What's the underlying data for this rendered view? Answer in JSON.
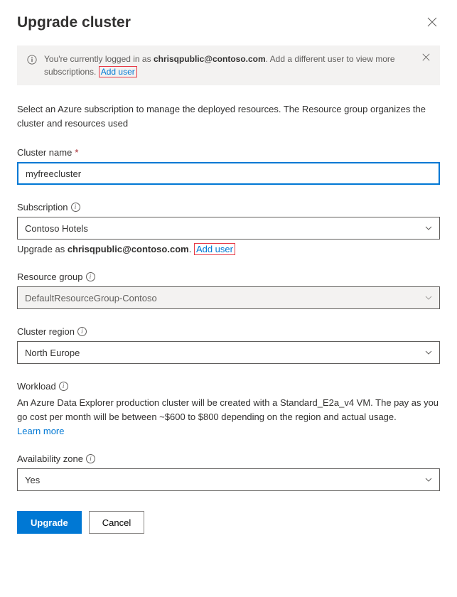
{
  "header": {
    "title": "Upgrade cluster",
    "close_label": "✕"
  },
  "banner": {
    "prefix": "You're currently logged in as ",
    "user": "chrisqpublic@contoso.com",
    "suffix": ". Add a different user to view more subscriptions.",
    "add_user": "Add user",
    "close_label": "✕"
  },
  "intro": "Select an Azure subscription to manage the deployed resources. The Resource group organizes the cluster and resources used",
  "cluster_name": {
    "label": "Cluster name",
    "value": "myfreecluster"
  },
  "subscription": {
    "label": "Subscription",
    "value": "Contoso Hotels",
    "helper_prefix": "Upgrade as ",
    "helper_user": "chrisqpublic@contoso.com",
    "helper_period": ". ",
    "add_user": "Add user"
  },
  "resource_group": {
    "label": "Resource group",
    "value": "DefaultResourceGroup-Contoso"
  },
  "cluster_region": {
    "label": "Cluster region",
    "value": "North Europe"
  },
  "workload": {
    "label": "Workload",
    "description": "An Azure Data Explorer production cluster will be created with a Standard_E2a_v4 VM. The pay as you go cost per month will be between ~$600 to $800 depending on the region and actual usage.",
    "learn_more": "Learn more"
  },
  "availability_zone": {
    "label": "Availability zone",
    "value": "Yes"
  },
  "buttons": {
    "upgrade": "Upgrade",
    "cancel": "Cancel"
  }
}
